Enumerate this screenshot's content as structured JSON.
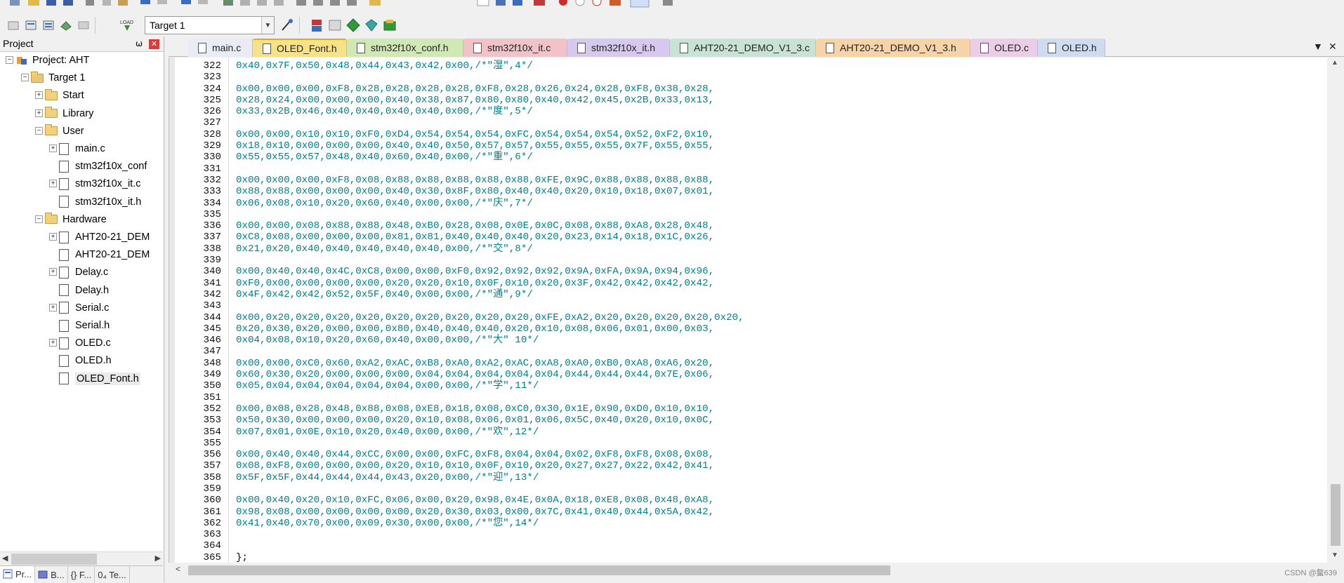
{
  "toolbar": {
    "target_select": "Target 1"
  },
  "project_panel": {
    "title": "Project",
    "pin_glyph": "⍵",
    "close_glyph": "✕",
    "tree": [
      {
        "label": "Project: AHT",
        "kind": "project",
        "level": 0,
        "expander": "−"
      },
      {
        "label": "Target 1",
        "kind": "target",
        "level": 1,
        "expander": "−"
      },
      {
        "label": "Start",
        "kind": "folder",
        "level": 2,
        "expander": "+"
      },
      {
        "label": "Library",
        "kind": "folder",
        "level": 2,
        "expander": "+"
      },
      {
        "label": "User",
        "kind": "folder",
        "level": 2,
        "expander": "−"
      },
      {
        "label": "main.c",
        "kind": "file",
        "level": 3,
        "expander": "+"
      },
      {
        "label": "stm32f10x_conf",
        "kind": "file",
        "level": 3,
        "expander": ""
      },
      {
        "label": "stm32f10x_it.c",
        "kind": "file",
        "level": 3,
        "expander": "+"
      },
      {
        "label": "stm32f10x_it.h",
        "kind": "file",
        "level": 3,
        "expander": ""
      },
      {
        "label": "Hardware",
        "kind": "folder",
        "level": 2,
        "expander": "−"
      },
      {
        "label": "AHT20-21_DEM",
        "kind": "file",
        "level": 3,
        "expander": "+"
      },
      {
        "label": "AHT20-21_DEM",
        "kind": "file",
        "level": 3,
        "expander": ""
      },
      {
        "label": "Delay.c",
        "kind": "file",
        "level": 3,
        "expander": "+"
      },
      {
        "label": "Delay.h",
        "kind": "file",
        "level": 3,
        "expander": ""
      },
      {
        "label": "Serial.c",
        "kind": "file",
        "level": 3,
        "expander": "+"
      },
      {
        "label": "Serial.h",
        "kind": "file",
        "level": 3,
        "expander": ""
      },
      {
        "label": "OLED.c",
        "kind": "file",
        "level": 3,
        "expander": "+"
      },
      {
        "label": "OLED.h",
        "kind": "file",
        "level": 3,
        "expander": ""
      },
      {
        "label": "OLED_Font.h",
        "kind": "file",
        "level": 3,
        "expander": "",
        "selected": true
      }
    ],
    "bottom_tabs": [
      "Pr...",
      "B...",
      "{} F...",
      "0₄ Te..."
    ]
  },
  "editor": {
    "tabs": [
      {
        "label": "main.c",
        "color": "#e9ecf5",
        "active": false
      },
      {
        "label": "OLED_Font.h",
        "color": "#f6e28a",
        "active": true
      },
      {
        "label": "stm32f10x_conf.h",
        "color": "#cfe8b4",
        "active": false
      },
      {
        "label": "stm32f10x_it.c",
        "color": "#f1c3c9",
        "active": false
      },
      {
        "label": "stm32f10x_it.h",
        "color": "#d6c8ee",
        "active": false
      },
      {
        "label": "AHT20-21_DEMO_V1_3.c",
        "color": "#c8e2d6",
        "active": false
      },
      {
        "label": "AHT20-21_DEMO_V1_3.h",
        "color": "#f6d3a8",
        "active": false
      },
      {
        "label": "OLED.c",
        "color": "#ebcde7",
        "active": false
      },
      {
        "label": "OLED.h",
        "color": "#cddcf0",
        "active": false
      }
    ],
    "tab_menu_glyph": "▼",
    "tab_close_glyph": "✕",
    "lines": [
      {
        "n": "322",
        "t": "0x40,0x7F,0x50,0x48,0x44,0x43,0x42,0x00,/*\"湿\",4*/"
      },
      {
        "n": "323",
        "t": ""
      },
      {
        "n": "324",
        "t": "0x00,0x00,0x00,0xF8,0x28,0x28,0x28,0x28,0xF8,0x28,0x26,0x24,0x28,0xF8,0x38,0x28,"
      },
      {
        "n": "325",
        "t": "0x28,0x24,0x00,0x00,0x00,0x40,0x38,0x87,0x80,0x80,0x40,0x42,0x45,0x2B,0x33,0x13,"
      },
      {
        "n": "326",
        "t": "0x33,0x2B,0x46,0x40,0x40,0x40,0x40,0x00,/*\"度\",5*/"
      },
      {
        "n": "327",
        "t": ""
      },
      {
        "n": "328",
        "t": "0x00,0x00,0x10,0x10,0xF0,0xD4,0x54,0x54,0x54,0xFC,0x54,0x54,0x54,0x52,0xF2,0x10,"
      },
      {
        "n": "329",
        "t": "0x18,0x10,0x00,0x00,0x00,0x40,0x40,0x50,0x57,0x57,0x55,0x55,0x55,0x7F,0x55,0x55,"
      },
      {
        "n": "330",
        "t": "0x55,0x55,0x57,0x48,0x40,0x60,0x40,0x00,/*\"重\",6*/"
      },
      {
        "n": "331",
        "t": ""
      },
      {
        "n": "332",
        "t": "0x00,0x00,0x00,0xF8,0x08,0x88,0x88,0x88,0x88,0x88,0xFE,0x9C,0x88,0x88,0x88,0x88,"
      },
      {
        "n": "333",
        "t": "0x88,0x88,0x00,0x00,0x00,0x40,0x30,0x8F,0x80,0x40,0x40,0x20,0x10,0x18,0x07,0x01,"
      },
      {
        "n": "334",
        "t": "0x06,0x08,0x10,0x20,0x60,0x40,0x00,0x00,/*\"庆\",7*/"
      },
      {
        "n": "335",
        "t": ""
      },
      {
        "n": "336",
        "t": "0x00,0x00,0x08,0x88,0x88,0x48,0xB0,0x28,0x08,0x0E,0x0C,0x08,0x88,0xA8,0x28,0x48,"
      },
      {
        "n": "337",
        "t": "0xC8,0x08,0x00,0x00,0x00,0x81,0x81,0x40,0x40,0x40,0x20,0x23,0x14,0x18,0x1C,0x26,"
      },
      {
        "n": "338",
        "t": "0x21,0x20,0x40,0x40,0x40,0x40,0x40,0x00,/*\"交\",8*/"
      },
      {
        "n": "339",
        "t": ""
      },
      {
        "n": "340",
        "t": "0x00,0x40,0x40,0x4C,0xC8,0x00,0x00,0xF0,0x92,0x92,0x92,0x9A,0xFA,0x9A,0x94,0x96,"
      },
      {
        "n": "341",
        "t": "0xF0,0x00,0x00,0x00,0x00,0x20,0x20,0x10,0x0F,0x10,0x20,0x3F,0x42,0x42,0x42,0x42,"
      },
      {
        "n": "342",
        "t": "0x4F,0x42,0x42,0x52,0x5F,0x40,0x00,0x00,/*\"通\",9*/"
      },
      {
        "n": "343",
        "t": ""
      },
      {
        "n": "344",
        "t": "0x00,0x20,0x20,0x20,0x20,0x20,0x20,0x20,0x20,0x20,0xFE,0xA2,0x20,0x20,0x20,0x20,0x20,"
      },
      {
        "n": "345",
        "t": "0x20,0x30,0x20,0x00,0x00,0x80,0x40,0x40,0x40,0x20,0x10,0x08,0x06,0x01,0x00,0x03,"
      },
      {
        "n": "346",
        "t": "0x04,0x08,0x10,0x20,0x60,0x40,0x00,0x00,/*\"大\" 10*/"
      },
      {
        "n": "347",
        "t": ""
      },
      {
        "n": "348",
        "t": "0x00,0x00,0xC0,0x60,0xA2,0xAC,0xB8,0xA0,0xA2,0xAC,0xA8,0xA0,0xB0,0xA8,0xA6,0x20,"
      },
      {
        "n": "349",
        "t": "0x60,0x30,0x20,0x00,0x00,0x00,0x04,0x04,0x04,0x04,0x04,0x44,0x44,0x44,0x7E,0x06,"
      },
      {
        "n": "350",
        "t": "0x05,0x04,0x04,0x04,0x04,0x04,0x00,0x00,/*\"学\",11*/"
      },
      {
        "n": "351",
        "t": ""
      },
      {
        "n": "352",
        "t": "0x00,0x08,0x28,0x48,0x88,0x08,0xE8,0x18,0x08,0xC0,0x30,0x1E,0x90,0xD0,0x10,0x10,"
      },
      {
        "n": "353",
        "t": "0x50,0x30,0x00,0x00,0x00,0x20,0x10,0x08,0x06,0x01,0x06,0x5C,0x40,0x20,0x10,0x0C,"
      },
      {
        "n": "354",
        "t": "0x07,0x01,0x0E,0x10,0x20,0x40,0x00,0x00,/*\"欢\",12*/"
      },
      {
        "n": "355",
        "t": ""
      },
      {
        "n": "356",
        "t": "0x00,0x40,0x40,0x44,0xCC,0x00,0x00,0xFC,0xF8,0x04,0x04,0x02,0xF8,0xF8,0x08,0x08,"
      },
      {
        "n": "357",
        "t": "0x08,0xF8,0x00,0x00,0x00,0x20,0x10,0x10,0x0F,0x10,0x20,0x27,0x27,0x22,0x42,0x41,"
      },
      {
        "n": "358",
        "t": "0x5F,0x5F,0x44,0x44,0x44,0x43,0x20,0x00,/*\"迎\",13*/"
      },
      {
        "n": "359",
        "t": ""
      },
      {
        "n": "360",
        "t": "0x00,0x40,0x20,0x10,0xFC,0x06,0x00,0x20,0x98,0x4E,0x0A,0x18,0xE8,0x08,0x48,0xA8,"
      },
      {
        "n": "361",
        "t": "0x98,0x08,0x00,0x00,0x00,0x00,0x20,0x30,0x03,0x00,0x7C,0x41,0x40,0x44,0x5A,0x42,"
      },
      {
        "n": "362",
        "t": "0x41,0x40,0x70,0x00,0x09,0x30,0x00,0x00,/*\"您\",14*/"
      },
      {
        "n": "363",
        "t": ""
      },
      {
        "n": "364",
        "t": ""
      },
      {
        "n": "365",
        "t": "};",
        "plain": true
      }
    ]
  },
  "watermark": "CSDN @鳌639"
}
